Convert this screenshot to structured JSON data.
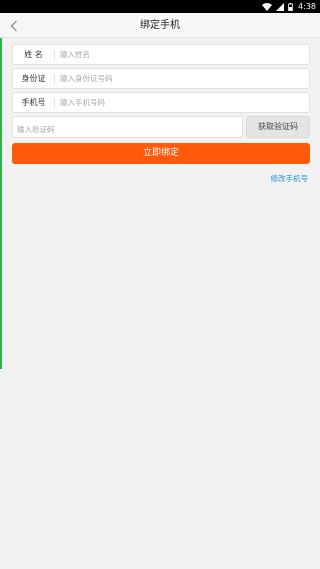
{
  "status_bar": {
    "time": "4:38",
    "icons": [
      "wifi-icon",
      "signal-icon",
      "battery-icon"
    ]
  },
  "header": {
    "title": "绑定手机",
    "back_icon": "chevron-left-icon"
  },
  "form": {
    "name": {
      "label": "姓 名",
      "placeholder": "输入姓名",
      "value": ""
    },
    "id_card": {
      "label": "身份证",
      "placeholder": "输入身份证号码",
      "value": ""
    },
    "phone": {
      "label": "手机号",
      "placeholder": "输入手机号码",
      "value": ""
    },
    "code": {
      "placeholder": "输入验证码",
      "value": ""
    },
    "get_code_label": "获取验证码",
    "submit_label": "立即绑定",
    "modify_phone_label": "修改手机号"
  },
  "colors": {
    "primary": "#ff5a0a",
    "link": "#1d8fe0",
    "background": "#f2f2f2",
    "edge_accent": "#2db54a"
  }
}
